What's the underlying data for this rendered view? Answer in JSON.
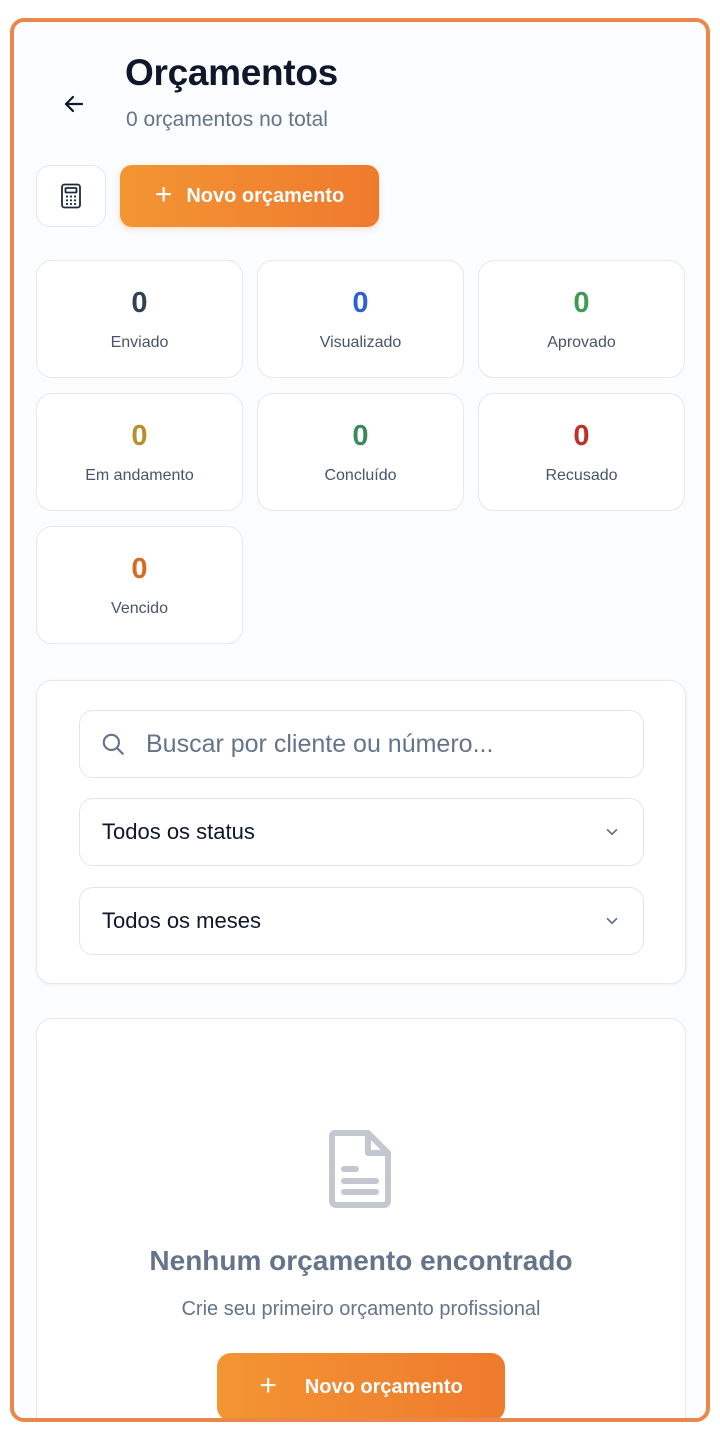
{
  "header": {
    "title": "Orçamentos",
    "subtitle": "0 orçamentos no total",
    "new_button_label": "Novo orçamento"
  },
  "stats": [
    {
      "value": "0",
      "label": "Enviado",
      "color": "#334155"
    },
    {
      "value": "0",
      "label": "Visualizado",
      "color": "#2f5fd6"
    },
    {
      "value": "0",
      "label": "Aprovado",
      "color": "#3f9b52"
    },
    {
      "value": "0",
      "label": "Em andamento",
      "color": "#b8902a"
    },
    {
      "value": "0",
      "label": "Concluído",
      "color": "#3a8a5c"
    },
    {
      "value": "0",
      "label": "Recusado",
      "color": "#c2302a"
    },
    {
      "value": "0",
      "label": "Vencido",
      "color": "#d86a22"
    }
  ],
  "filters": {
    "search_placeholder": "Buscar por cliente ou número...",
    "status_select": "Todos os status",
    "month_select": "Todos os meses"
  },
  "empty_state": {
    "title": "Nenhum orçamento encontrado",
    "subtitle": "Crie seu primeiro orçamento profissional",
    "button_label": "Novo orçamento"
  },
  "colors": {
    "accent_start": "#f39533",
    "accent_end": "#ef7a2d",
    "frame_border": "#e8894a"
  }
}
